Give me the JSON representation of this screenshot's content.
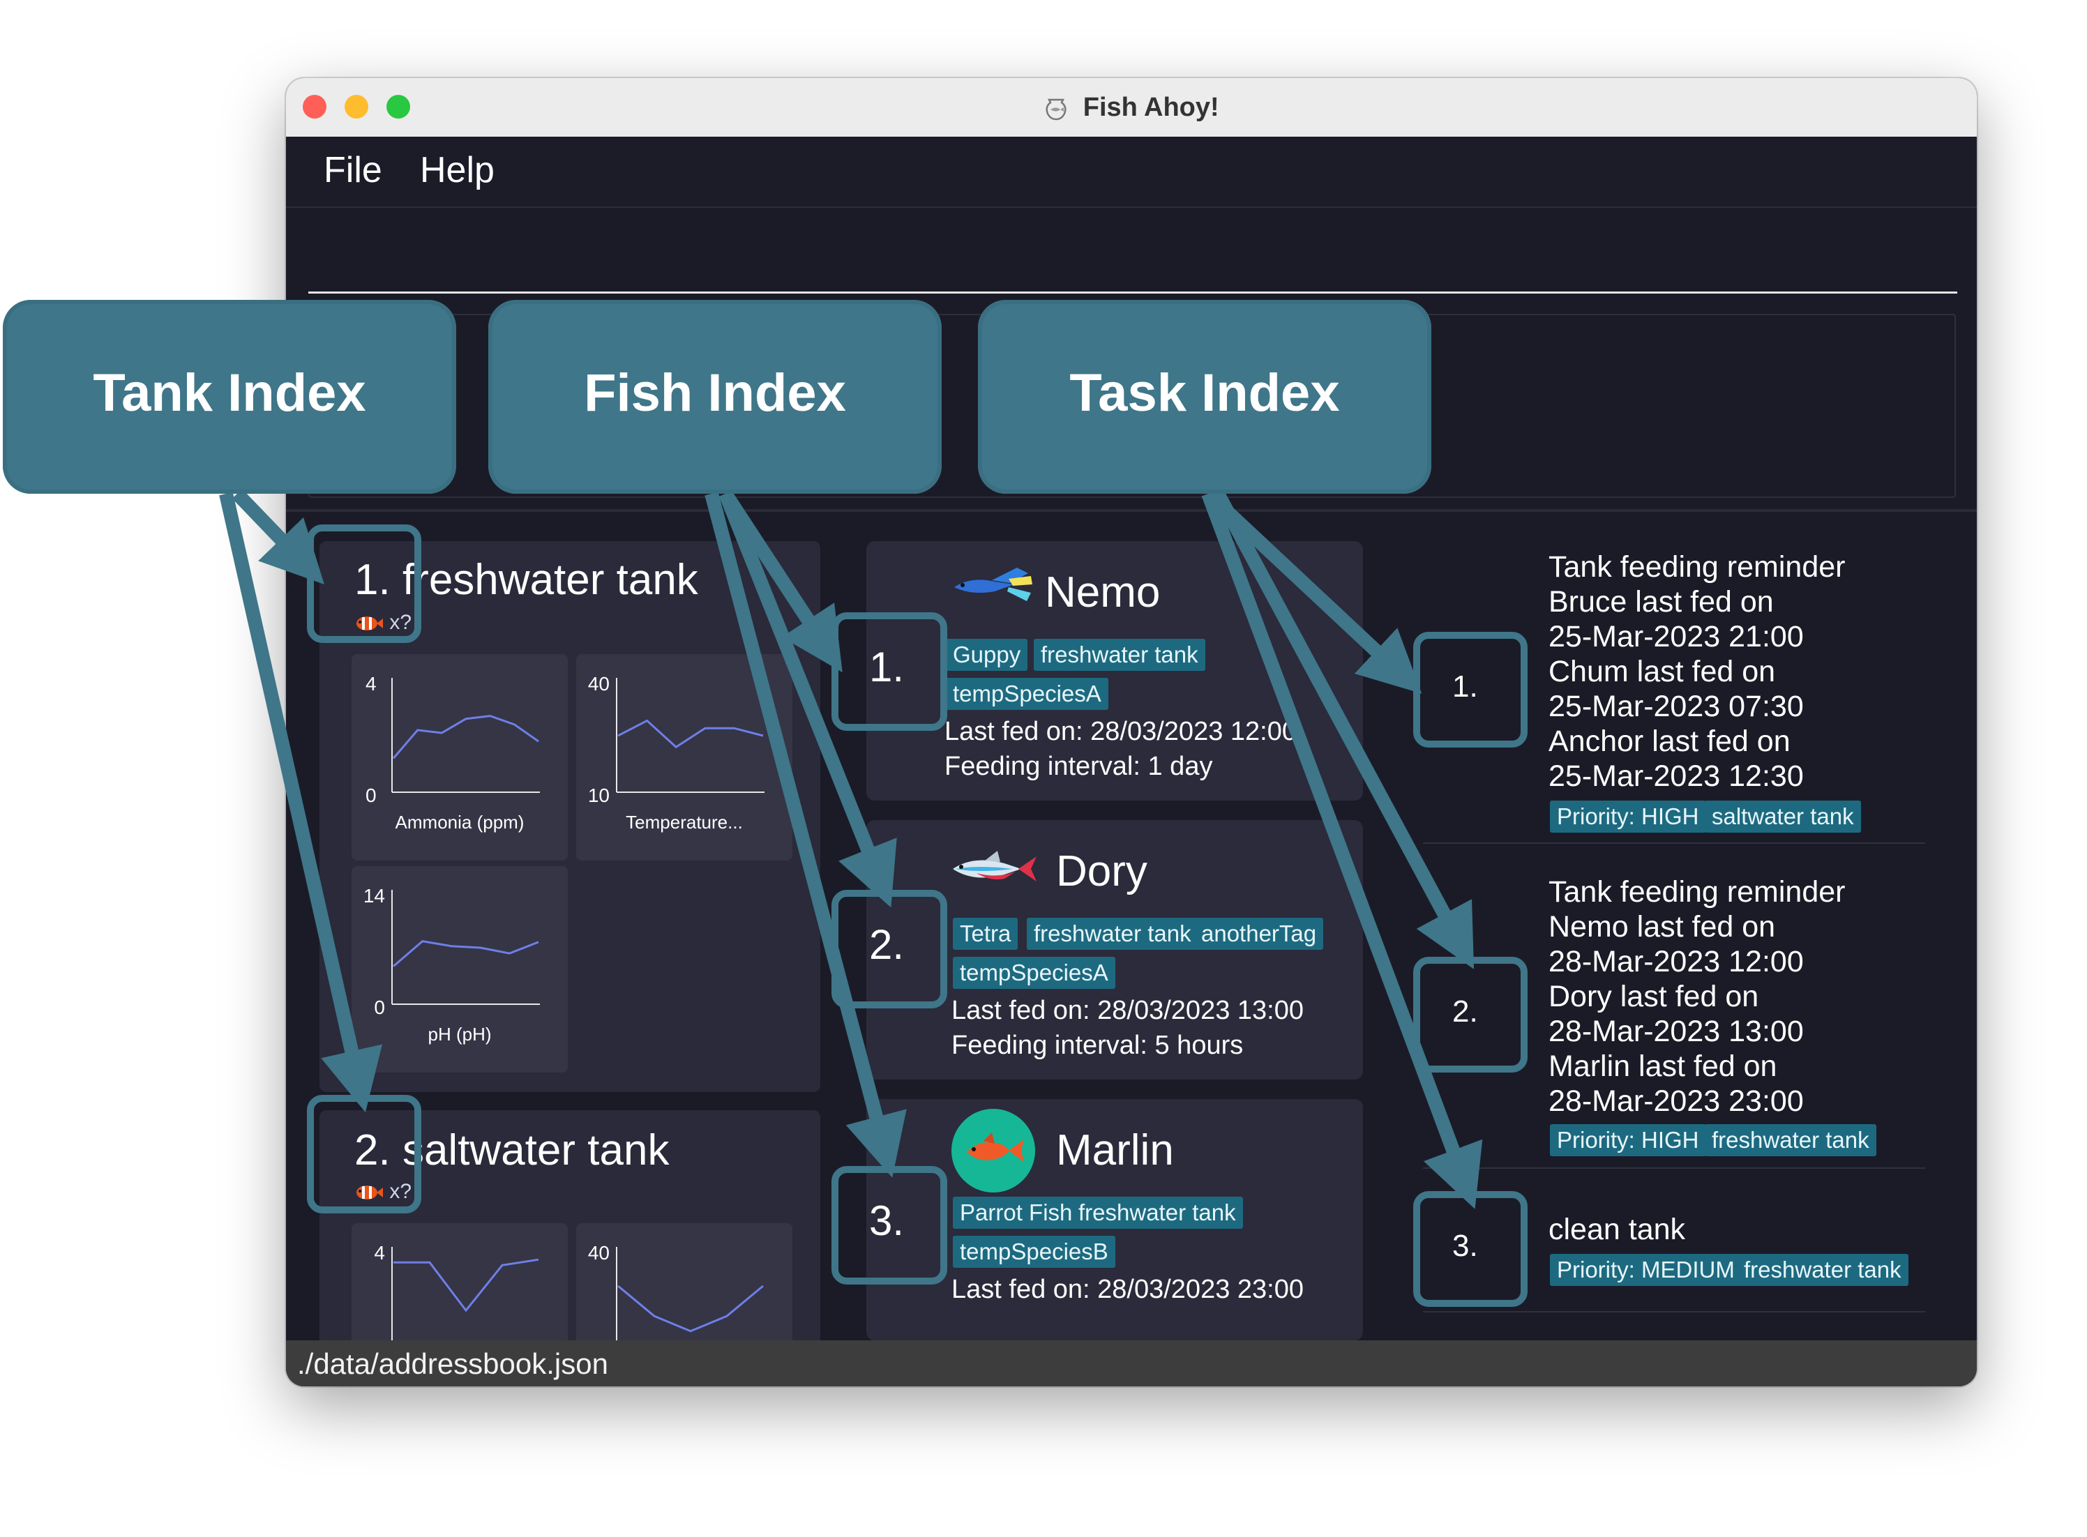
{
  "window": {
    "title": "Fish Ahoy!",
    "traffic_lights": {
      "close": "#ff5f57",
      "minimize": "#febc2e",
      "zoom": "#28c840"
    }
  },
  "menu": {
    "file": "File",
    "help": "Help"
  },
  "command": {
    "value": ""
  },
  "result": {
    "partial_text": "l t"
  },
  "tanks": [
    {
      "index": "1.",
      "name": "freshwater tank",
      "count": "x?",
      "charts": [
        {
          "name": "Ammonia (ppm)",
          "ymin": "0",
          "ymax": "4",
          "values": [
            1.2,
            2.2,
            2.1,
            2.6,
            2.7,
            2.4,
            1.8
          ]
        },
        {
          "name": "Temperature...",
          "ymin": "10",
          "ymax": "40",
          "values": [
            25,
            29,
            22,
            27,
            27,
            25
          ]
        },
        {
          "name": "pH (pH)",
          "ymin": "0",
          "ymax": "14",
          "values": [
            4.7,
            7.8,
            7.2,
            7.0,
            6.3,
            7.7
          ]
        }
      ]
    },
    {
      "index": "2.",
      "name": "saltwater tank",
      "count": "x?",
      "charts": [
        {
          "ymax": "4",
          "values": [
            3.5,
            3.5,
            1.8,
            3.4,
            3.6
          ]
        },
        {
          "ymax": "40",
          "values": [
            30,
            22,
            18,
            22,
            30
          ]
        }
      ]
    }
  ],
  "fish": [
    {
      "index": "1.",
      "name": "Nemo",
      "tags": [
        "Guppy",
        "freshwater tank",
        "tempSpeciesA"
      ],
      "last_fed": "Last fed on: 28/03/2023 12:00",
      "interval": "Feeding interval: 1 day"
    },
    {
      "index": "2.",
      "name": "Dory",
      "tags": [
        "Tetra",
        "freshwater tank",
        "anotherTag",
        "tempSpeciesA"
      ],
      "last_fed": "Last fed on: 28/03/2023 13:00",
      "interval": "Feeding interval: 5 hours"
    },
    {
      "index": "3.",
      "name": "Marlin",
      "tags": [
        "Parrot Fish",
        "freshwater tank",
        "tempSpeciesB"
      ],
      "last_fed": "Last fed on: 28/03/2023 23:00",
      "interval": ""
    }
  ],
  "tasks": [
    {
      "index": "1.",
      "lines": [
        "Tank feeding reminder",
        "Bruce last fed on",
        "25-Mar-2023 21:00",
        "Chum last fed on",
        "25-Mar-2023 07:30",
        "Anchor last fed on",
        "25-Mar-2023 12:30"
      ],
      "tags": [
        "Priority: HIGH",
        "saltwater tank"
      ]
    },
    {
      "index": "2.",
      "lines": [
        "Tank feeding reminder",
        "Nemo last fed on",
        "28-Mar-2023 12:00",
        "Dory last fed on",
        "28-Mar-2023 13:00",
        "Marlin last fed on",
        "28-Mar-2023 23:00"
      ],
      "tags": [
        "Priority: HIGH",
        "freshwater tank"
      ]
    },
    {
      "index": "3.",
      "lines": [
        "clean tank"
      ],
      "tags": [
        "Priority: MEDIUM",
        "freshwater tank"
      ]
    }
  ],
  "status": {
    "path": "./data/addressbook.json"
  },
  "annotations": {
    "tank_index": "Tank Index",
    "fish_index": "Fish Index",
    "task_index": "Task Index",
    "color": "#3f7689"
  },
  "colors": {
    "background": "#1b1b27",
    "card": "#2a2a3a",
    "tag": "#1d6a80",
    "chart_line": "#6f7fe6"
  }
}
